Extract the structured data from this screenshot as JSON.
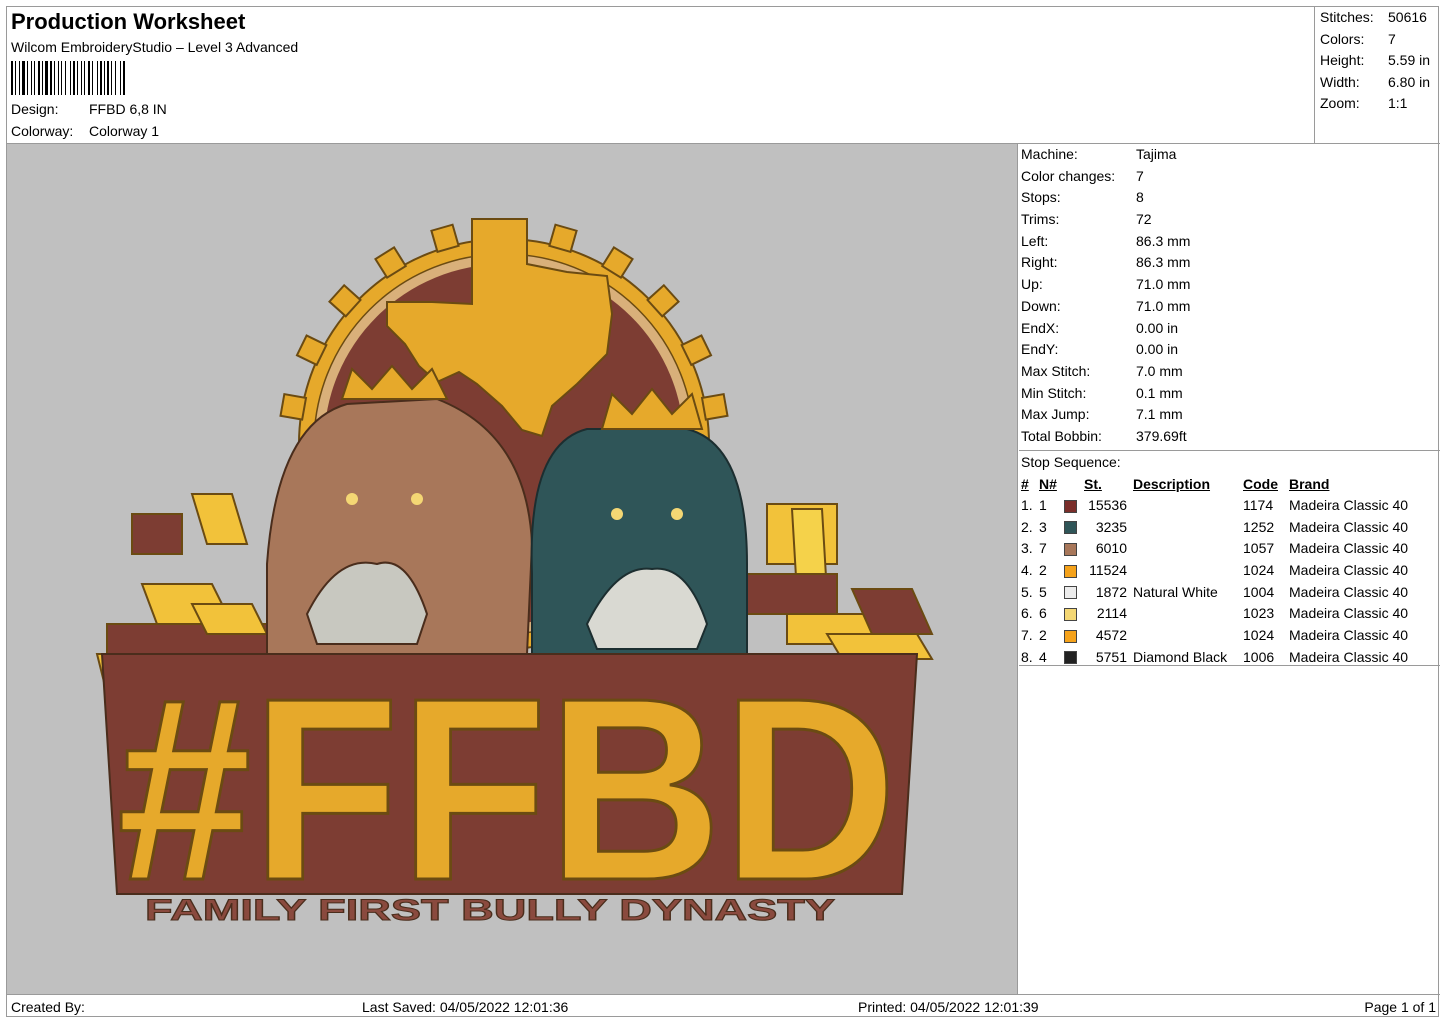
{
  "header": {
    "title": "Production Worksheet",
    "subtitle": "Wilcom EmbroideryStudio – Level 3 Advanced",
    "design_label": "Design:",
    "design_value": "FFBD 6,8 IN",
    "colorway_label": "Colorway:",
    "colorway_value": "Colorway 1"
  },
  "stats": [
    {
      "k": "Stitches:",
      "v": "50616"
    },
    {
      "k": "Colors:",
      "v": "7"
    },
    {
      "k": "Height:",
      "v": "5.59 in"
    },
    {
      "k": "Width:",
      "v": "6.80 in"
    },
    {
      "k": "Zoom:",
      "v": "1:1"
    }
  ],
  "machine": [
    {
      "k": "Machine:",
      "v": "Tajima"
    },
    {
      "k": "Color changes:",
      "v": "7"
    },
    {
      "k": "Stops:",
      "v": "8"
    },
    {
      "k": "Trims:",
      "v": "72"
    },
    {
      "k": "Left:",
      "v": "86.3 mm"
    },
    {
      "k": "Right:",
      "v": "86.3 mm"
    },
    {
      "k": "Up:",
      "v": "71.0 mm"
    },
    {
      "k": "Down:",
      "v": "71.0 mm"
    },
    {
      "k": "EndX:",
      "v": "0.00 in"
    },
    {
      "k": "EndY:",
      "v": "0.00 in"
    },
    {
      "k": "Max Stitch:",
      "v": "7.0 mm"
    },
    {
      "k": "Min Stitch:",
      "v": "0.1 mm"
    },
    {
      "k": "Max Jump:",
      "v": "7.1 mm"
    },
    {
      "k": "Total Bobbin:",
      "v": "379.69ft"
    }
  ],
  "stop_sequence": {
    "heading": "Stop Sequence:",
    "columns": {
      "num": "#",
      "n": "N#",
      "st": "St.",
      "desc": "Description",
      "code": "Code",
      "brand": "Brand"
    },
    "rows": [
      {
        "num": "1.",
        "n": "1",
        "color": "#7a2e2a",
        "st": "15536",
        "desc": "",
        "code": "1174",
        "brand": "Madeira Classic 40"
      },
      {
        "num": "2.",
        "n": "3",
        "color": "#2f5558",
        "st": "3235",
        "desc": "",
        "code": "1252",
        "brand": "Madeira Classic 40"
      },
      {
        "num": "3.",
        "n": "7",
        "color": "#a8775a",
        "st": "6010",
        "desc": "",
        "code": "1057",
        "brand": "Madeira Classic 40"
      },
      {
        "num": "4.",
        "n": "2",
        "color": "#f5a21a",
        "st": "11524",
        "desc": "",
        "code": "1024",
        "brand": "Madeira Classic 40"
      },
      {
        "num": "5.",
        "n": "5",
        "color": "#ececec",
        "st": "1872",
        "desc": "Natural White",
        "code": "1004",
        "brand": "Madeira Classic 40"
      },
      {
        "num": "6.",
        "n": "6",
        "color": "#f4d774",
        "st": "2114",
        "desc": "",
        "code": "1023",
        "brand": "Madeira Classic 40"
      },
      {
        "num": "7.",
        "n": "2",
        "color": "#f5a21a",
        "st": "4572",
        "desc": "",
        "code": "1024",
        "brand": "Madeira Classic 40"
      },
      {
        "num": "8.",
        "n": "4",
        "color": "#222222",
        "st": "5751",
        "desc": "Diamond Black",
        "code": "1006",
        "brand": "Madeira Classic 40"
      }
    ]
  },
  "design_art": {
    "main_text": "#FFBD",
    "tagline": "FAMILY FIRST BULLY DYNASTY"
  },
  "footer": {
    "created": "Created By:",
    "saved": "Last Saved: 04/05/2022 12:01:36",
    "printed": "Printed: 04/05/2022 12:01:39",
    "page": "Page 1 of 1"
  }
}
